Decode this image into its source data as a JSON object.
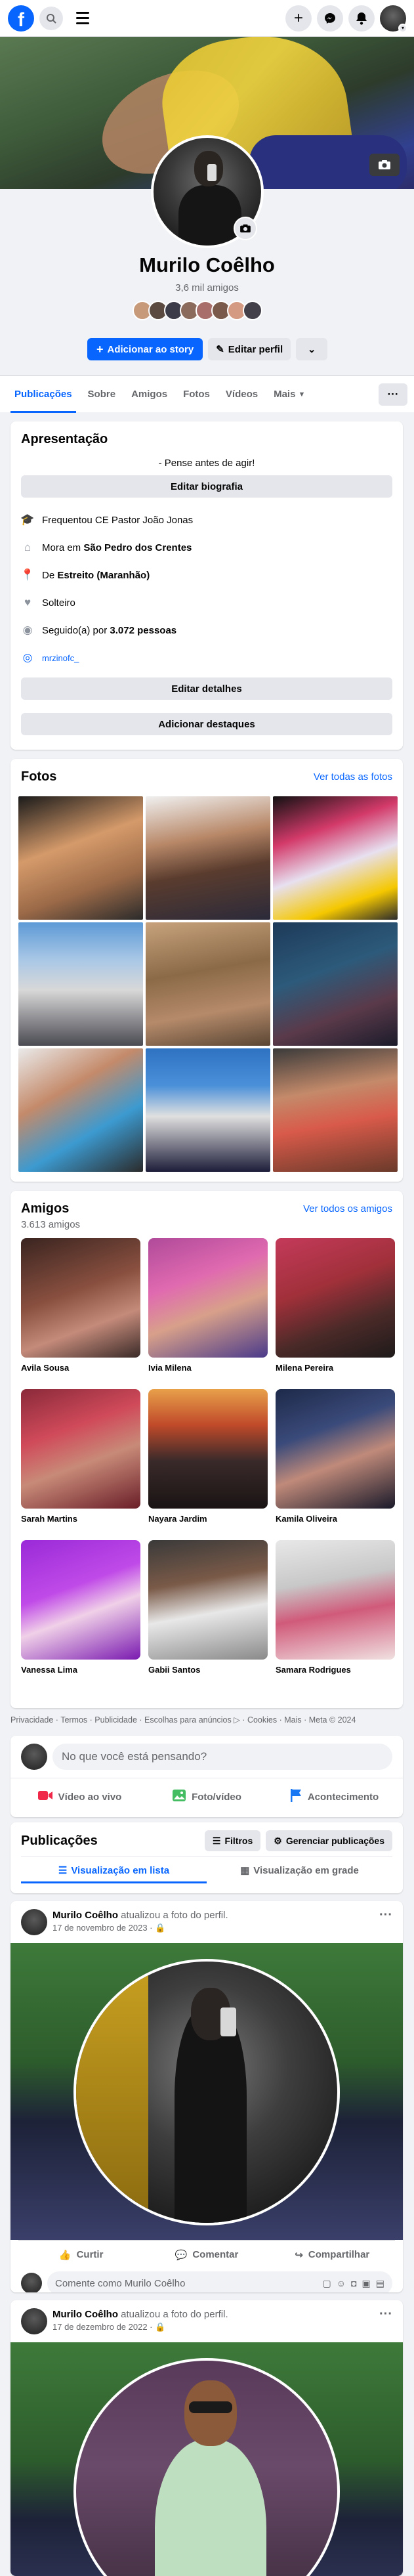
{
  "topbar": {
    "logo": "f",
    "search_icon": "search-icon",
    "menu_icon": "menu-icon",
    "plus": "+",
    "messenger_icon": "messenger-icon",
    "bell_icon": "bell-icon"
  },
  "profile": {
    "name": "Murilo Coêlho",
    "friends_count": "3,6 mil amigos",
    "add_story": "Adicionar ao story",
    "edit_profile": "Editar perfil"
  },
  "tabs": [
    "Publicações",
    "Sobre",
    "Amigos",
    "Fotos",
    "Vídeos",
    "Mais"
  ],
  "intro": {
    "title": "Apresentação",
    "bio": "- Pense antes de agir!",
    "edit_bio": "Editar biografia",
    "rows": [
      {
        "icon": "school-icon",
        "prefix": "Frequentou CE Pastor João Jonas",
        "bold": ""
      },
      {
        "icon": "home-icon",
        "prefix": "Mora em ",
        "bold": "São Pedro dos Crentes"
      },
      {
        "icon": "location-pin-icon",
        "prefix": "De ",
        "bold": "Estreito (Maranhão)"
      },
      {
        "icon": "heart-icon",
        "prefix": "Solteiro",
        "bold": ""
      },
      {
        "icon": "rss-icon",
        "prefix": "Seguido(a) por ",
        "bold": "3.072 pessoas"
      }
    ],
    "instagram": "mrzinofc_",
    "edit_details": "Editar detalhes",
    "add_featured": "Adicionar destaques"
  },
  "photos": {
    "title": "Fotos",
    "see_all": "Ver todas as fotos"
  },
  "friends": {
    "title": "Amigos",
    "count": "3.613 amigos",
    "see_all": "Ver todos os amigos",
    "list": [
      "Avila Sousa",
      "Ivia Milena",
      "Milena Pereira",
      "Sarah Martins",
      "Nayara Jardim",
      "Kamila Oliveira",
      "Vanessa Lima",
      "Gabii Santos",
      "Samara Rodrigues"
    ]
  },
  "footer": "Privacidade · Termos · Publicidade · Escolhas para anúncios ▷ · Cookies · Mais · Meta © 2024",
  "composer": {
    "placeholder": "No que você está pensando?",
    "live": "Vídeo ao vivo",
    "photo": "Foto/vídeo",
    "event": "Acontecimento"
  },
  "publications": {
    "title": "Publicações",
    "filters": "Filtros",
    "manage": "Gerenciar publicações",
    "list_view": "Visualização em lista",
    "grid_view": "Visualização em grade"
  },
  "posts": [
    {
      "author": "Murilo Coêlho",
      "action": " atualizou a foto do perfil.",
      "date": "17 de novembro de 2023 · 🔒"
    },
    {
      "author": "Murilo Coêlho",
      "action": " atualizou a foto do perfil.",
      "date": "17 de dezembro de 2022 · 🔒"
    }
  ],
  "post_actions": {
    "like": "Curtir",
    "comment": "Comentar",
    "share": "Compartilhar",
    "comment_placeholder": "Comente como Murilo Coêlho"
  },
  "colors": {
    "brand": "#0866ff",
    "page_bg": "#f0f2f5"
  }
}
